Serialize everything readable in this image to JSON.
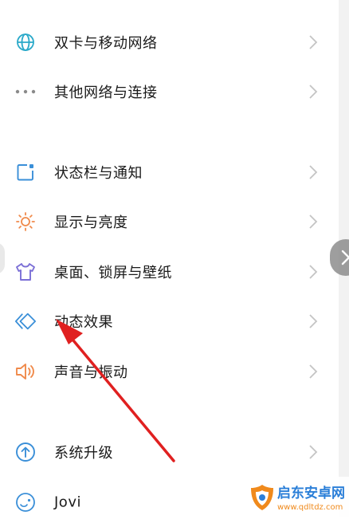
{
  "settings_list": {
    "items": [
      {
        "label": "双卡与移动网络",
        "icon": "globe-icon"
      },
      {
        "label": "其他网络与连接",
        "icon": "more-dots-icon"
      },
      {
        "label": "状态栏与通知",
        "icon": "status-bar-notification-icon"
      },
      {
        "label": "显示与亮度",
        "icon": "brightness-sun-icon"
      },
      {
        "label": "桌面、锁屏与壁纸",
        "icon": "tshirt-theme-icon"
      },
      {
        "label": "动态效果",
        "icon": "dynamic-effects-diamond-icon"
      },
      {
        "label": "声音与振动",
        "icon": "speaker-sound-icon"
      },
      {
        "label": "系统升级",
        "icon": "upgrade-arrow-icon"
      },
      {
        "label": "Jovi",
        "icon": "jovi-icon"
      }
    ]
  },
  "annotation": {
    "type": "red-arrow",
    "target": "动态效果",
    "color": "#e02020"
  },
  "watermark": {
    "title": "启东安卓网",
    "url": "www.qdltdz.com"
  },
  "colors": {
    "icon_teal": "#2aa9c9",
    "icon_blue": "#3a8fd8",
    "icon_orange": "#f08a4b",
    "icon_purple": "#7b6fd6",
    "icon_gray": "#8a8a8a",
    "chevron": "#c4c4c4"
  }
}
